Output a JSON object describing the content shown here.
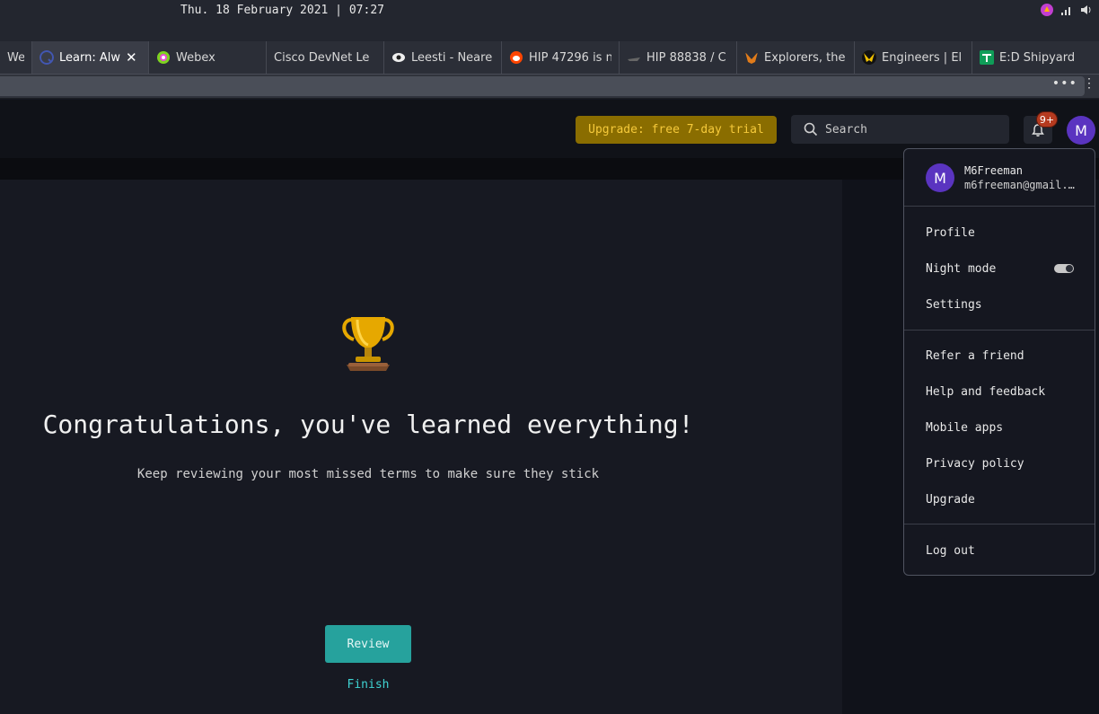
{
  "system": {
    "datetime": "Thu. 18 February 2021  |  07:27"
  },
  "browser": {
    "tabs": [
      {
        "title": "Webl",
        "icon": "web-icon"
      },
      {
        "title": "Learn: Alw",
        "icon": "quizlet-icon",
        "active": true
      },
      {
        "title": "Webex",
        "icon": "webex-icon"
      },
      {
        "title": "Cisco DevNet Le",
        "icon": "none"
      },
      {
        "title": "Leesti - Neare",
        "icon": "eye-icon"
      },
      {
        "title": "HIP 47296 is n",
        "icon": "reddit-icon"
      },
      {
        "title": "HIP 88838 / C",
        "icon": "ship-icon"
      },
      {
        "title": "Explorers, the",
        "icon": "fox-icon"
      },
      {
        "title": "Engineers | El",
        "icon": "wings-icon"
      },
      {
        "title": "E:D Shipyard",
        "icon": "sheet-icon"
      }
    ],
    "menu_dots": "•••",
    "kebab": "⋮"
  },
  "header": {
    "upgrade_label": "Upgrade: free 7-day trial",
    "search_placeholder": "Search",
    "notif_count": "9+",
    "avatar_letter": "M",
    "colors": {
      "upgrade_bg": "#8a6d00",
      "upgrade_text": "#f5c93a",
      "avatar": "#5a34c0"
    }
  },
  "main": {
    "headline": "Congratulations, you've learned everything!",
    "subtitle": "Keep reviewing your most missed terms to make sure they stick",
    "review_label": "Review",
    "finish_label": "Finish",
    "colors": {
      "review_bg": "#26a29d",
      "finish": "#3fd3d3"
    }
  },
  "account_menu": {
    "avatar_letter": "M",
    "username": "M6Freeman",
    "email": "m6freeman@gmail.…",
    "items_top": [
      "Profile",
      "Night mode",
      "Settings"
    ],
    "night_mode_on": true,
    "items_mid": [
      "Refer a friend",
      "Help and feedback",
      "Mobile apps",
      "Privacy policy",
      "Upgrade"
    ],
    "items_bottom": [
      "Log out"
    ]
  }
}
